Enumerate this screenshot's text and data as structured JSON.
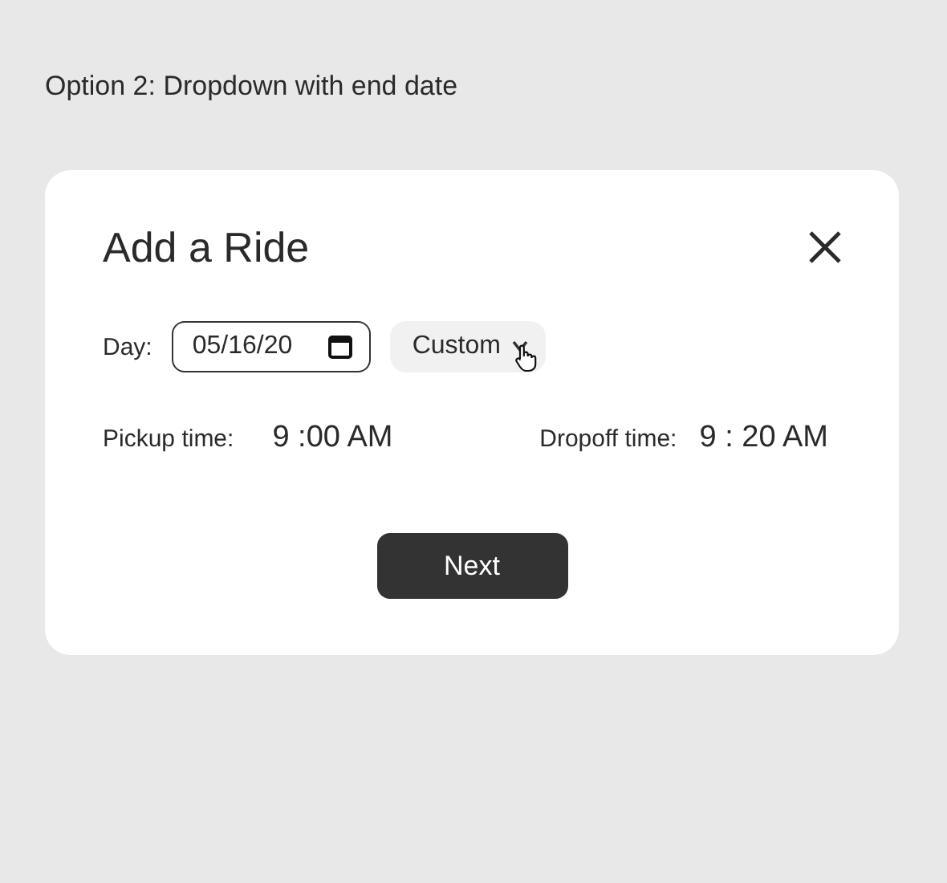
{
  "heading": "Option 2: Dropdown with end date",
  "dialog": {
    "title": "Add a Ride",
    "day": {
      "label": "Day:",
      "value": "05/16/20"
    },
    "repeat_dropdown": {
      "value": "Custom"
    },
    "pickup": {
      "label": "Pickup time:",
      "value": "9 :00 AM"
    },
    "dropoff": {
      "label": "Dropoff time:",
      "value": "9 : 20 AM"
    },
    "button": "Next"
  }
}
